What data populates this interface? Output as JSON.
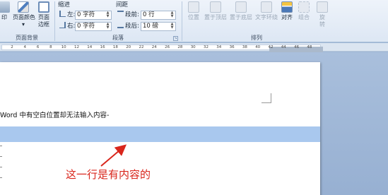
{
  "ribbon": {
    "page_background_group": {
      "label": "页面背景",
      "buttons": [
        {
          "label": "印",
          "icon": "print-icon"
        },
        {
          "label": "页面颜色",
          "sub": "▾",
          "icon": "page-color-icon"
        },
        {
          "label": "页面",
          "sub": "边框",
          "icon": "page-border-icon"
        }
      ]
    },
    "paragraph_group": {
      "label": "段落",
      "indent_header": "缩进",
      "spacing_header": "间距",
      "indent_left_label": "左:",
      "indent_left_value": "0 字符",
      "indent_right_label": "右:",
      "indent_right_value": "0 字符",
      "spacing_before_label": "段前:",
      "spacing_before_value": "0 行",
      "spacing_after_label": "段后:",
      "spacing_after_value": "10 磅"
    },
    "arrange_group": {
      "label": "排列",
      "buttons": [
        {
          "label": "位置",
          "sub": "",
          "icon": "position-icon",
          "enabled": false
        },
        {
          "label": "置于顶层",
          "sub": "",
          "icon": "bring-front-icon",
          "enabled": false
        },
        {
          "label": "置于底层",
          "sub": "",
          "icon": "send-back-icon",
          "enabled": false
        },
        {
          "label": "文字环绕",
          "sub": "",
          "icon": "text-wrap-icon",
          "enabled": false
        },
        {
          "label": "对齐",
          "sub": "",
          "icon": "align-icon",
          "enabled": true
        },
        {
          "label": "组合",
          "sub": "",
          "icon": "group-icon",
          "enabled": false
        },
        {
          "label": "旋",
          "sub": "转",
          "icon": "rotate-icon",
          "enabled": false
        }
      ]
    }
  },
  "ruler": {
    "marks": [
      "2",
      "4",
      "6",
      "8",
      "10",
      "12",
      "14",
      "16",
      "18",
      "20",
      "22",
      "24",
      "26",
      "28",
      "30",
      "32",
      "34",
      "36",
      "38",
      "40",
      "42",
      "44",
      "46",
      "48"
    ]
  },
  "document": {
    "text_line": "Word 中有空白位置却无法输入内容-",
    "annotation": "这一行是有内容的"
  },
  "colors": {
    "highlight": "#a9c8ee",
    "annotation": "#d9261c",
    "workspace": "#9fb7d6"
  }
}
